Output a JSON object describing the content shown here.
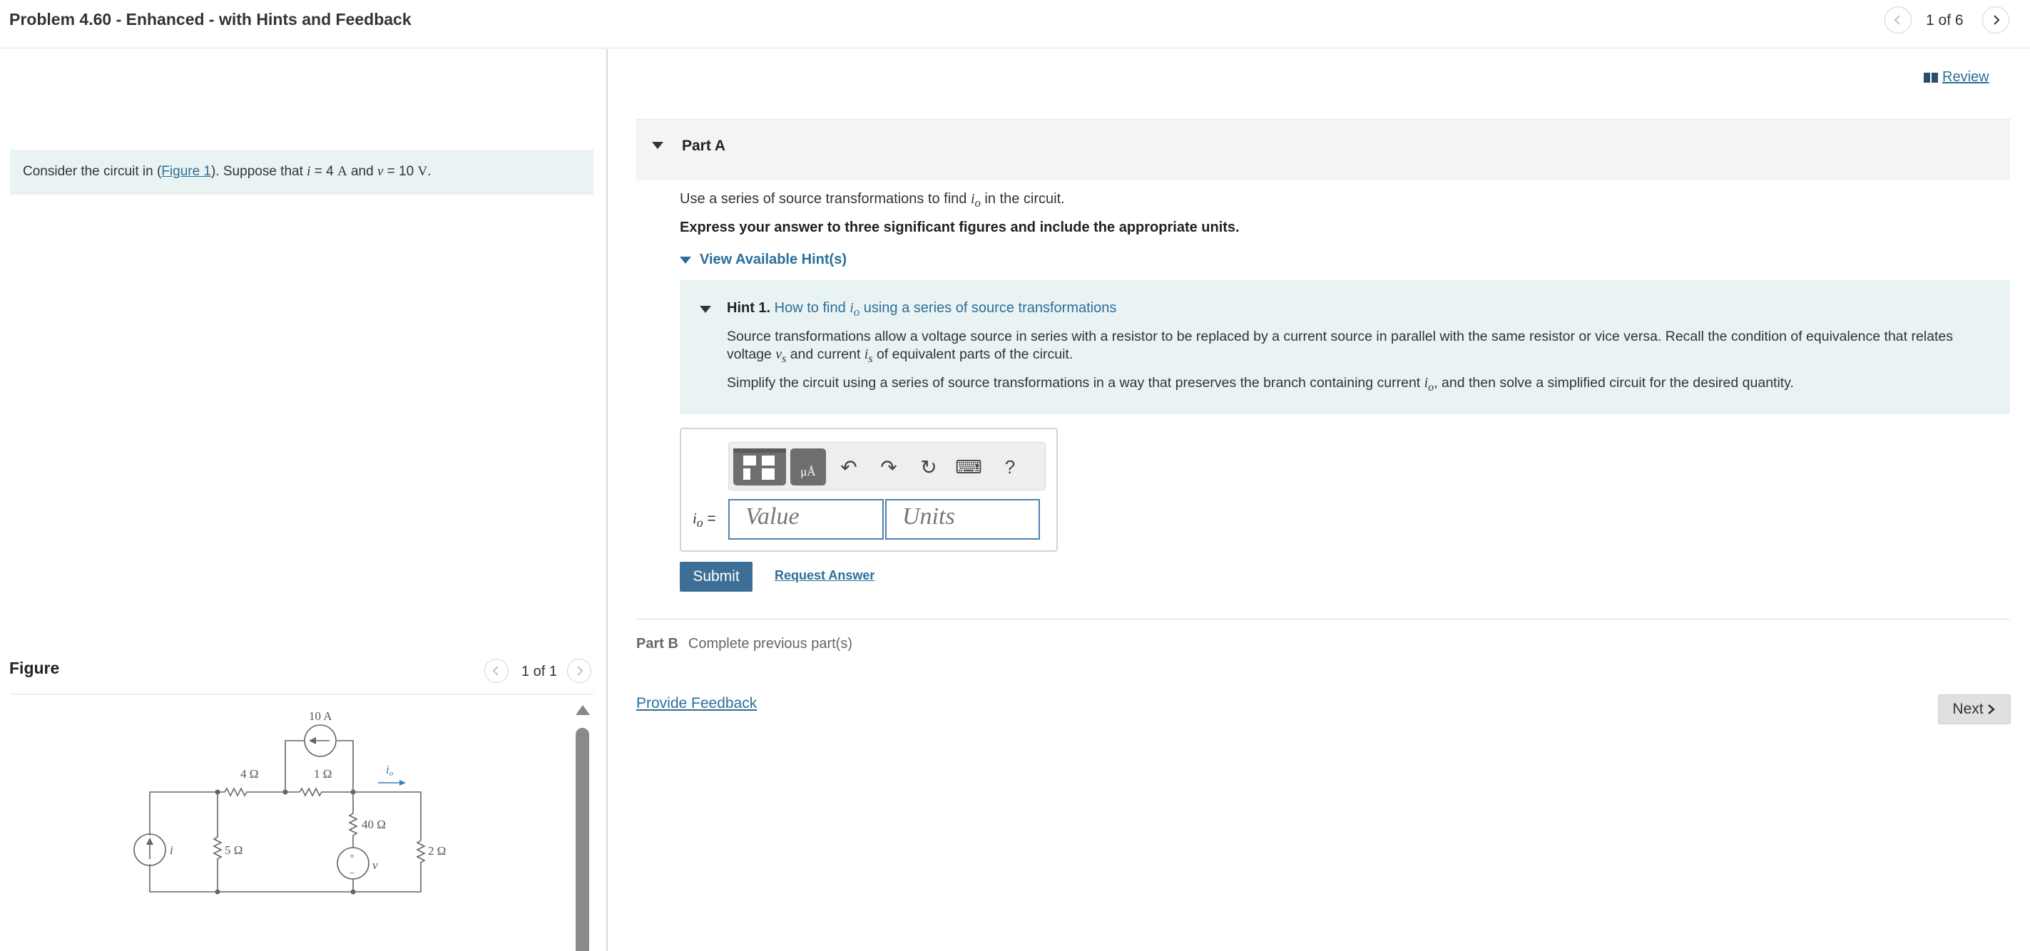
{
  "header": {
    "title": "Problem 4.60 - Enhanced - with Hints and Feedback",
    "counter": "1 of 6"
  },
  "intro": {
    "prefix": "Consider the circuit in (",
    "figure_link": "Figure 1",
    "mid": "). Suppose that ",
    "var_i": "i",
    "eq1": " = 4 ",
    "unit_A": "A",
    "and": " and ",
    "var_v": "v",
    "eq2": " = 10 ",
    "unit_V": "V",
    "end": "."
  },
  "figure": {
    "heading": "Figure",
    "counter": "1 of 1",
    "labels": {
      "src10": "10 A",
      "r4": "4 Ω",
      "r1": "1 Ω",
      "io": "i",
      "io_sub": "o",
      "r40": "40 Ω",
      "i": "i",
      "r5": "5 Ω",
      "r2": "2 Ω",
      "v": "v",
      "plus": "+",
      "minus": "−"
    }
  },
  "review": "Review",
  "partA": {
    "label": "Part A",
    "question_prefix": "Use a series of source transformations to find ",
    "question_var": "i",
    "question_sub": "o",
    "question_suffix": " in the circuit.",
    "instruction": "Express your answer to three significant figures and include the appropriate units.",
    "hints_toggle": "View Available Hint(s)",
    "hint": {
      "number": "Hint 1.",
      "title_prefix": " How to find ",
      "title_var": "i",
      "title_sub": "o",
      "title_suffix": " using a series of source transformations",
      "p1_a": "Source transformations allow a voltage source in series with a resistor to be replaced by a current source in parallel with the same resistor or vice versa. Recall the condition of equivalence that relates voltage ",
      "p1_vs": "v",
      "p1_vs_sub": "s",
      "p1_b": " and current ",
      "p1_is": "i",
      "p1_is_sub": "s",
      "p1_c": " of equivalent parts of the circuit.",
      "p2_a": "Simplify the circuit using a series of source transformations in a way that preserves the branch containing current ",
      "p2_var": "i",
      "p2_sub": "o",
      "p2_b": ", and then solve a simplified circuit for the desired quantity."
    },
    "toolbar": {
      "symbols_glyph": "μÅ",
      "undo": "↶",
      "redo": "↷",
      "reset": "↻",
      "keyboard": "⌨",
      "help": "?"
    },
    "answer_label_var": "i",
    "answer_label_sub": "o",
    "answer_label_eq": " =",
    "value_placeholder": "Value",
    "units_placeholder": "Units",
    "submit": "Submit",
    "request_answer": "Request Answer"
  },
  "partB": {
    "label": "Part B",
    "status": "Complete previous part(s)"
  },
  "footer": {
    "feedback": "Provide Feedback",
    "next": "Next"
  }
}
